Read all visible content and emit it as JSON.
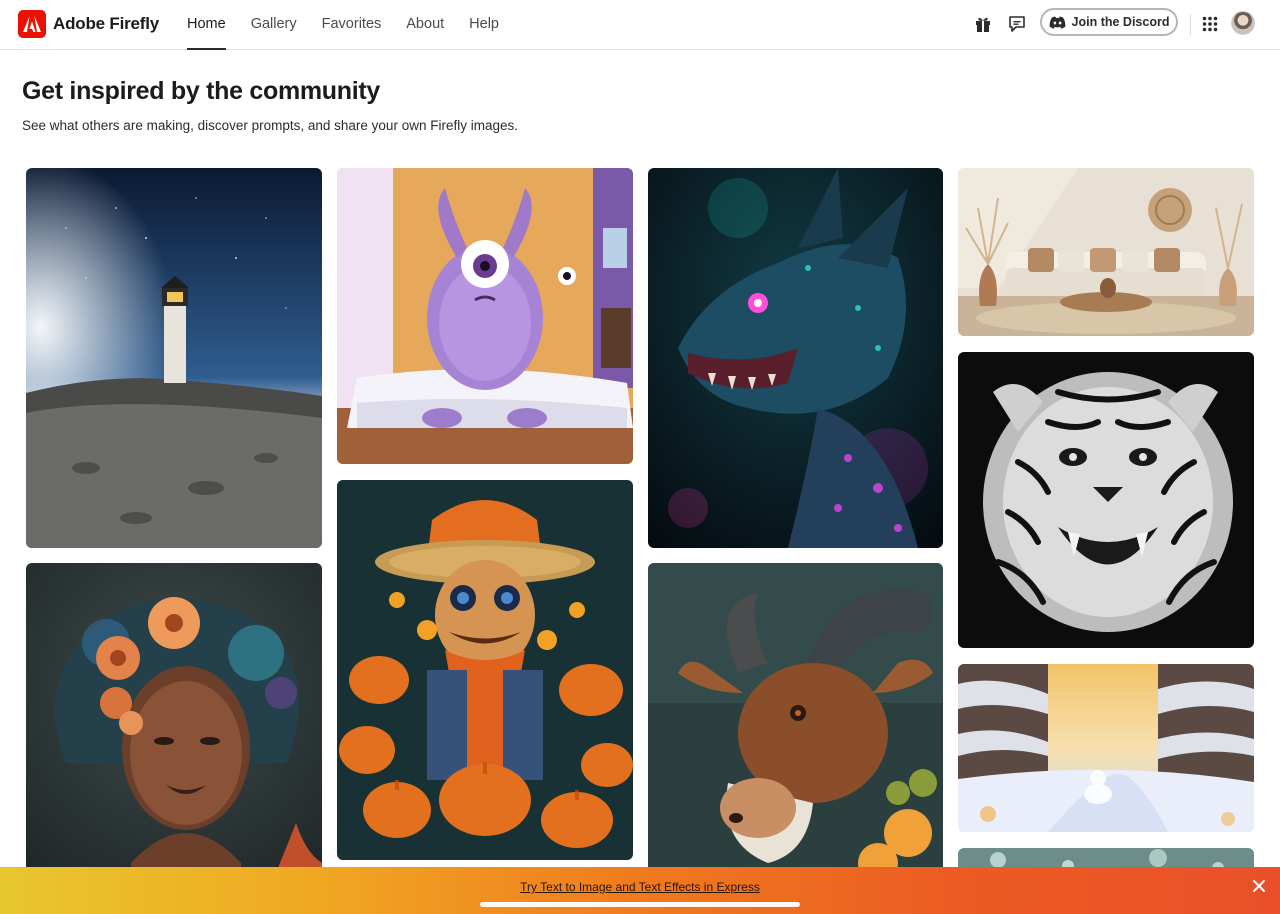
{
  "app": {
    "name": "Adobe Firefly",
    "accent_color": "#eb1000"
  },
  "nav": {
    "items": [
      {
        "label": "Home",
        "active": true
      },
      {
        "label": "Gallery",
        "active": false
      },
      {
        "label": "Favorites",
        "active": false
      },
      {
        "label": "About",
        "active": false
      },
      {
        "label": "Help",
        "active": false
      }
    ]
  },
  "toolbar": {
    "icons": [
      "gift-icon",
      "feedback-icon",
      "discord-icon",
      "apps-grid-icon"
    ],
    "discord_label": "Join the Discord"
  },
  "main": {
    "title": "Get inspired by the community",
    "subtitle": "See what others are making, discover prompts, and share your own Firefly images."
  },
  "gallery": {
    "columns": 4,
    "tiles": [
      "lighthouse",
      "purple-monster",
      "neon-dragon",
      "boho-living-room",
      "black-white-tiger",
      "flower-woman-portrait",
      "scarecrow-pumpkins",
      "goat",
      "winter-dog",
      "bokeh-partial"
    ]
  },
  "banner": {
    "link_label": "Try Text to Image and Text Effects in Express",
    "close_icon": "close-icon"
  }
}
